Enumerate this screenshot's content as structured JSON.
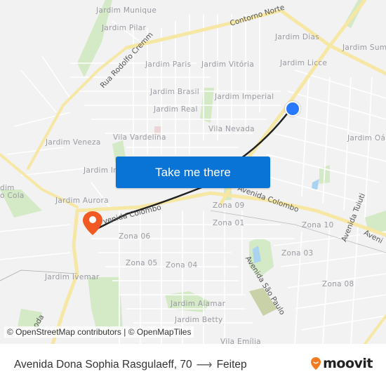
{
  "map": {
    "neighborhood_labels": [
      {
        "text": "Jardim Munique"
      },
      {
        "text": "Jardim Pilar"
      },
      {
        "text": "Jardim Dias"
      },
      {
        "text": "Jardim Sum"
      },
      {
        "text": "Jardim Paris"
      },
      {
        "text": "Jardim Vitória"
      },
      {
        "text": "Jardim Licce"
      },
      {
        "text": "Jardim Brasil"
      },
      {
        "text": "Jardim Imperial"
      },
      {
        "text": "Jardim Real"
      },
      {
        "text": "Vila Nevada"
      },
      {
        "text": "Vila Vardelina"
      },
      {
        "text": "Jardim Veneza"
      },
      {
        "text": "Jardim Oá"
      },
      {
        "text": "Jardim In"
      },
      {
        "text": "dim"
      },
      {
        "text": "o Cola"
      },
      {
        "text": "Jardim Aurora"
      },
      {
        "text": "Zona 09"
      },
      {
        "text": "Zona 01"
      },
      {
        "text": "Zona 10"
      },
      {
        "text": "Zona 06"
      },
      {
        "text": "Zona 03"
      },
      {
        "text": "Zona 05"
      },
      {
        "text": "Zona 04"
      },
      {
        "text": "Zona 08"
      },
      {
        "text": "Jardim Ivemar"
      },
      {
        "text": "Jardim Alamar"
      },
      {
        "text": "Jardim Betty"
      },
      {
        "text": "Vila Emília"
      }
    ],
    "road_labels": [
      {
        "text": "Contorno Norte"
      },
      {
        "text": "Rua Rodolfo Cremm"
      },
      {
        "text": "Avenida Colombo"
      },
      {
        "text": "venida Colombo"
      },
      {
        "text": "Avenida Tuiuti"
      },
      {
        "text": "Avenida São Paulo"
      },
      {
        "text": "Aveni"
      },
      {
        "text": "oda"
      }
    ],
    "origin_marker": {
      "color": "#2979ff"
    },
    "destination_marker": {
      "color": "#f05a22"
    },
    "route_color": "#222222"
  },
  "cta": {
    "label": "Take me there",
    "color": "#0a74d6"
  },
  "attribution": "© OpenStreetMap contributors | © OpenMapTiles",
  "footer": {
    "origin": "Avenida Dona Sophia Rasgulaeff, 70",
    "arrow": "⟶",
    "destination": "Feitep",
    "brand": "moovit",
    "brand_color": "#f47a20"
  }
}
